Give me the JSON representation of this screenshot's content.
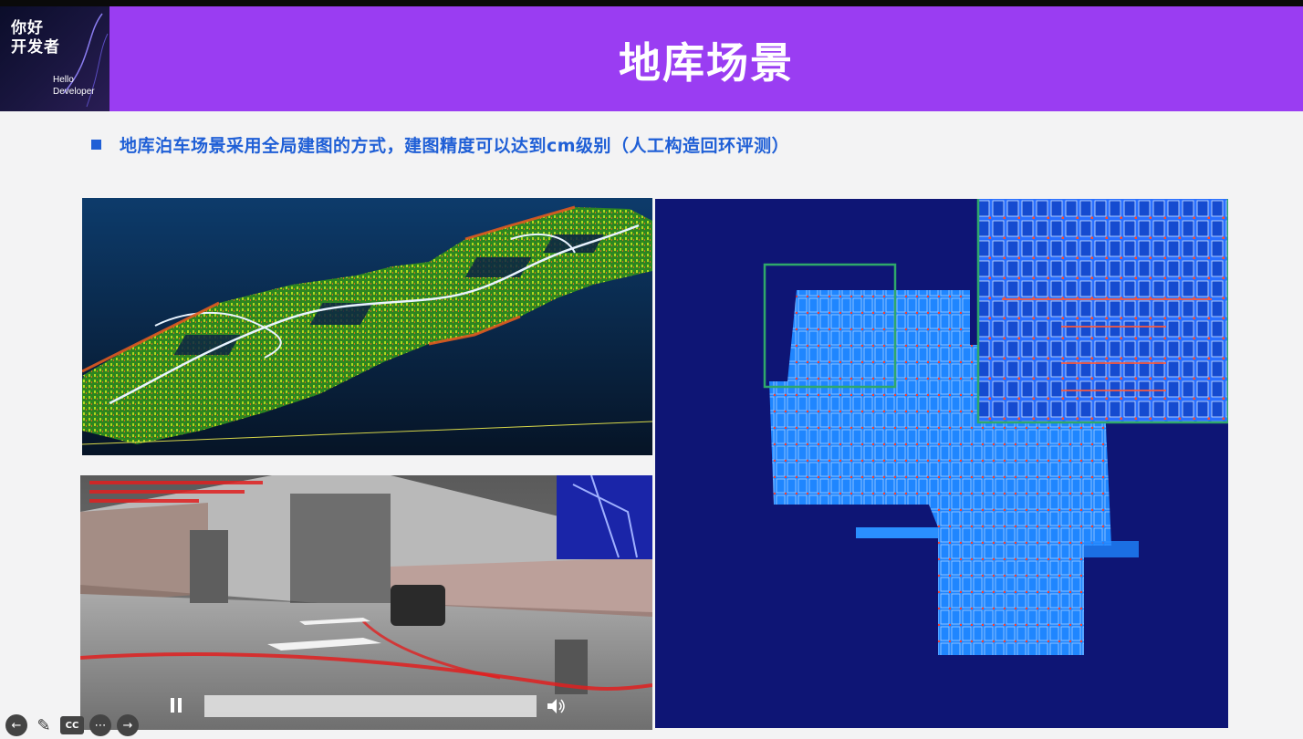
{
  "logo": {
    "cn_line1": "你好",
    "cn_line2": "开发者",
    "en_line1": "Hello",
    "en_line2": "Developer"
  },
  "header": {
    "title": "地库场景"
  },
  "bullet": {
    "text": "地库泊车场景采用全局建图的方式，建图精度可以达到cm级别（人工构造回环评测）"
  },
  "colors": {
    "header_bg": "#9a3df2",
    "bullet_blue": "#1f5fd6",
    "map_bg": "#0e1575",
    "inset_border": "#2fa86a"
  },
  "video": {
    "state": "playing",
    "progress": 0.0
  },
  "toolbar": {
    "cc_label": "CC"
  }
}
